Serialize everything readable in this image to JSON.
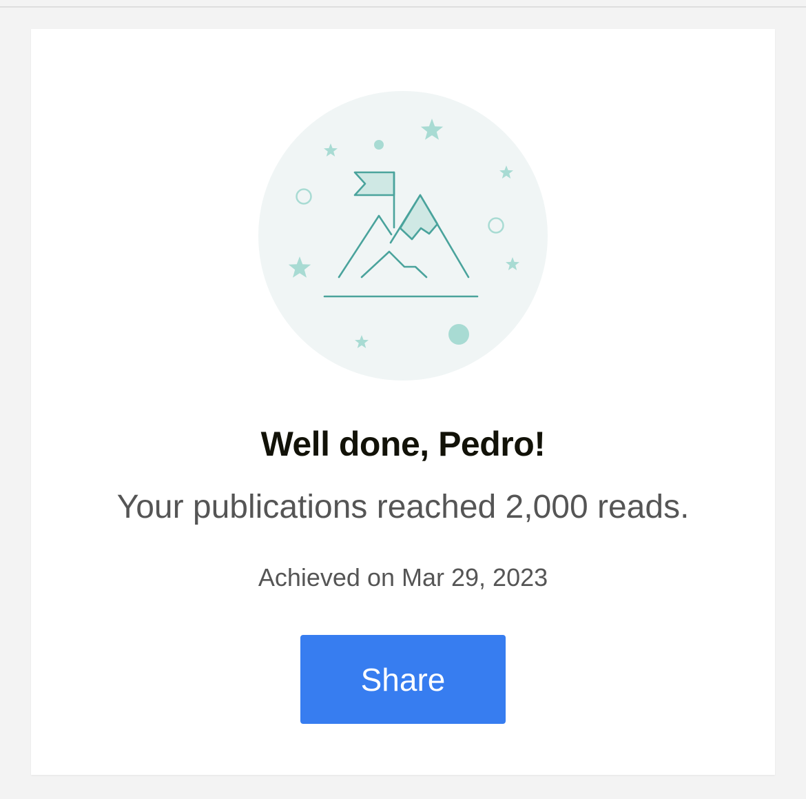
{
  "card": {
    "illustration": "mountain-summit-flag-icon",
    "headline": "Well done, Pedro!",
    "message": "Your publications reached 2,000 reads.",
    "achieved_date": "Achieved on Mar 29, 2023",
    "share_label": "Share"
  },
  "colors": {
    "page_background": "#f3f3f3",
    "card_background": "#ffffff",
    "circle_background": "#f0f5f5",
    "illustration_stroke": "#4aa39c",
    "illustration_fill": "#cfe8e4",
    "decor": "#a8dbd3",
    "headline_text": "#121208",
    "body_text": "#555555",
    "button_background": "#377df0",
    "button_text": "#ffffff"
  }
}
